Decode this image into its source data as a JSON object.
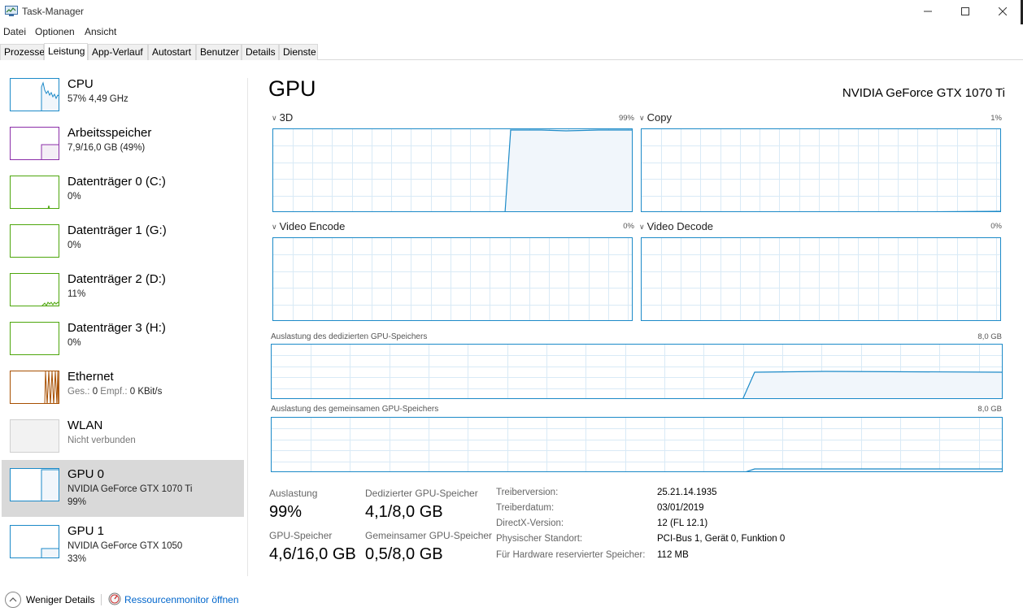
{
  "window": {
    "title": "Task-Manager",
    "icon": "task-manager-icon"
  },
  "menu": [
    "Datei",
    "Optionen",
    "Ansicht"
  ],
  "tabs": [
    "Prozesse",
    "Leistung",
    "App-Verlauf",
    "Autostart",
    "Benutzer",
    "Details",
    "Dienste"
  ],
  "active_tab": "Leistung",
  "sidebar": {
    "items": [
      {
        "name": "CPU",
        "sub": "57% 4,49 GHz",
        "color": "#1c8ac8"
      },
      {
        "name": "Arbeitsspeicher",
        "sub": "7,9/16,0 GB (49%)",
        "color": "#8b2ea8"
      },
      {
        "name": "Datenträger 0 (C:)",
        "sub": "0%",
        "color": "#4da60c"
      },
      {
        "name": "Datenträger 1 (G:)",
        "sub": "0%",
        "color": "#4da60c"
      },
      {
        "name": "Datenträger 2 (D:)",
        "sub": "11%",
        "color": "#4da60c"
      },
      {
        "name": "Datenträger 3 (H:)",
        "sub": "0%",
        "color": "#4da60c"
      },
      {
        "name": "Ethernet",
        "sub_label1": "Ges.:",
        "sub_value1": "0",
        "sub_label2": "Empf.:",
        "sub_value2": "0 KBit/s",
        "color": "#a74f01"
      },
      {
        "name": "WLAN",
        "sub": "Nicht verbunden",
        "color": "#cccccc"
      },
      {
        "name": "GPU 0",
        "sub": "NVIDIA GeForce GTX 1070 Ti",
        "sub2": "99%",
        "color": "#1c8ac8"
      },
      {
        "name": "GPU 1",
        "sub": "NVIDIA GeForce GTX 1050",
        "sub2": "33%",
        "color": "#1c8ac8"
      }
    ],
    "selected": "GPU 0"
  },
  "main": {
    "title": "GPU",
    "model": "NVIDIA GeForce GTX 1070 Ti",
    "engines": [
      {
        "name": "3D",
        "pct": "99%"
      },
      {
        "name": "Copy",
        "pct": "1%"
      },
      {
        "name": "Video Encode",
        "pct": "0%"
      },
      {
        "name": "Video Decode",
        "pct": "0%"
      }
    ],
    "dedicated_mem": {
      "label": "Auslastung des dedizierten GPU-Speichers",
      "max": "8,0 GB"
    },
    "shared_mem": {
      "label": "Auslastung des gemeinsamen GPU-Speichers",
      "max": "8,0 GB"
    },
    "stats": {
      "auslastung_label": "Auslastung",
      "auslastung_value": "99%",
      "dedicated_label": "Dedizierter GPU-Speicher",
      "dedicated_value": "4,1/8,0 GB",
      "gpu_mem_label": "GPU-Speicher",
      "gpu_mem_value": "4,6/16,0 GB",
      "shared_label": "Gemeinsamer GPU-Speicher",
      "shared_value": "0,5/8,0 GB"
    },
    "info": [
      {
        "label": "Treiberversion:",
        "value": "25.21.14.1935"
      },
      {
        "label": "Treiberdatum:",
        "value": "03/01/2019"
      },
      {
        "label": "DirectX-Version:",
        "value": "12 (FL 12.1)"
      },
      {
        "label": "Physischer Standort:",
        "value": "PCI-Bus 1, Gerät 0, Funktion 0"
      },
      {
        "label": "Für Hardware reservierter Speicher:",
        "value": "112 MB"
      }
    ]
  },
  "footer": {
    "less_details": "Weniger Details",
    "resmon": "Ressourcenmonitor öffnen"
  },
  "colors": {
    "gpu_line": "#1c8ac8",
    "gpu_fill": "#f1f6fb",
    "grid": "#d9eaf6",
    "selected_bg": "#d9d9d9",
    "link": "#0066cc"
  }
}
